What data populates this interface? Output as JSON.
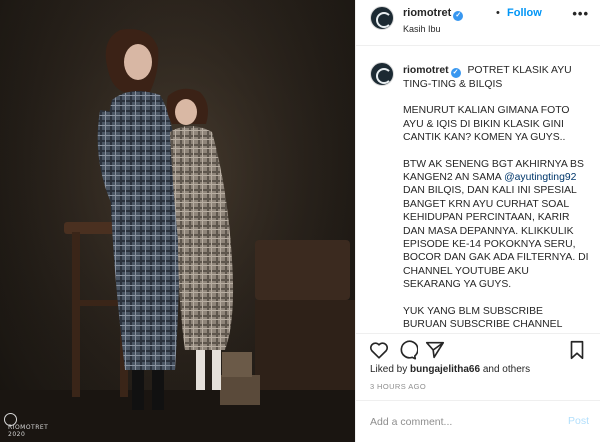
{
  "post": {
    "watermark_text": "RIOMOTRET",
    "watermark_year": "2020"
  },
  "header": {
    "username": "riomotret",
    "follow_label": "Follow",
    "location": "Kasih Ibu",
    "separator": "•",
    "more_label": "•••"
  },
  "caption": {
    "username": "riomotret",
    "title": "POTRET KLASIK AYU TING-TING & BILQIS",
    "paragraph_1": "MENURUT KALIAN GIMANA FOTO AYU & IQIS DI BIKIN KLASIK GINI CANTIK KAN? KOMEN YA GUYS..",
    "paragraph_2_before": "BTW AK SENENG BGT AKHIRNYA BS KANGEN2 AN SAMA ",
    "mention": "@ayutingting92",
    "paragraph_2_after": " DAN BILQIS, DAN KALI INI SPESIAL BANGET KRN AYU CURHAT SOAL KEHIDUPAN PERCINTAAN, KARIR DAN MASA DEPANNYA. KLIKKULIK EPISODE KE-14 POKOKNYA SERU, BOCOR DAN GAK ADA FILTERNYA. DI CHANNEL YOUTUBE AKU SEKARANG YA GUYS.",
    "paragraph_3": "YUK YANG BLM SUBSCRIBE BURUAN SUBSCRIBE CHANNEL YOUTUBE RIOMOTRET BIAR KAGAK"
  },
  "likes": {
    "prefix": "Liked by ",
    "user": "bungajelitha66",
    "suffix": " and others"
  },
  "timestamp": "3 HOURS AGO",
  "comment": {
    "placeholder": "Add a comment...",
    "post_label": "Post"
  },
  "colors": {
    "accent": "#0095f6",
    "verified": "#3897f0",
    "post_disabled": "#b2dffc"
  }
}
